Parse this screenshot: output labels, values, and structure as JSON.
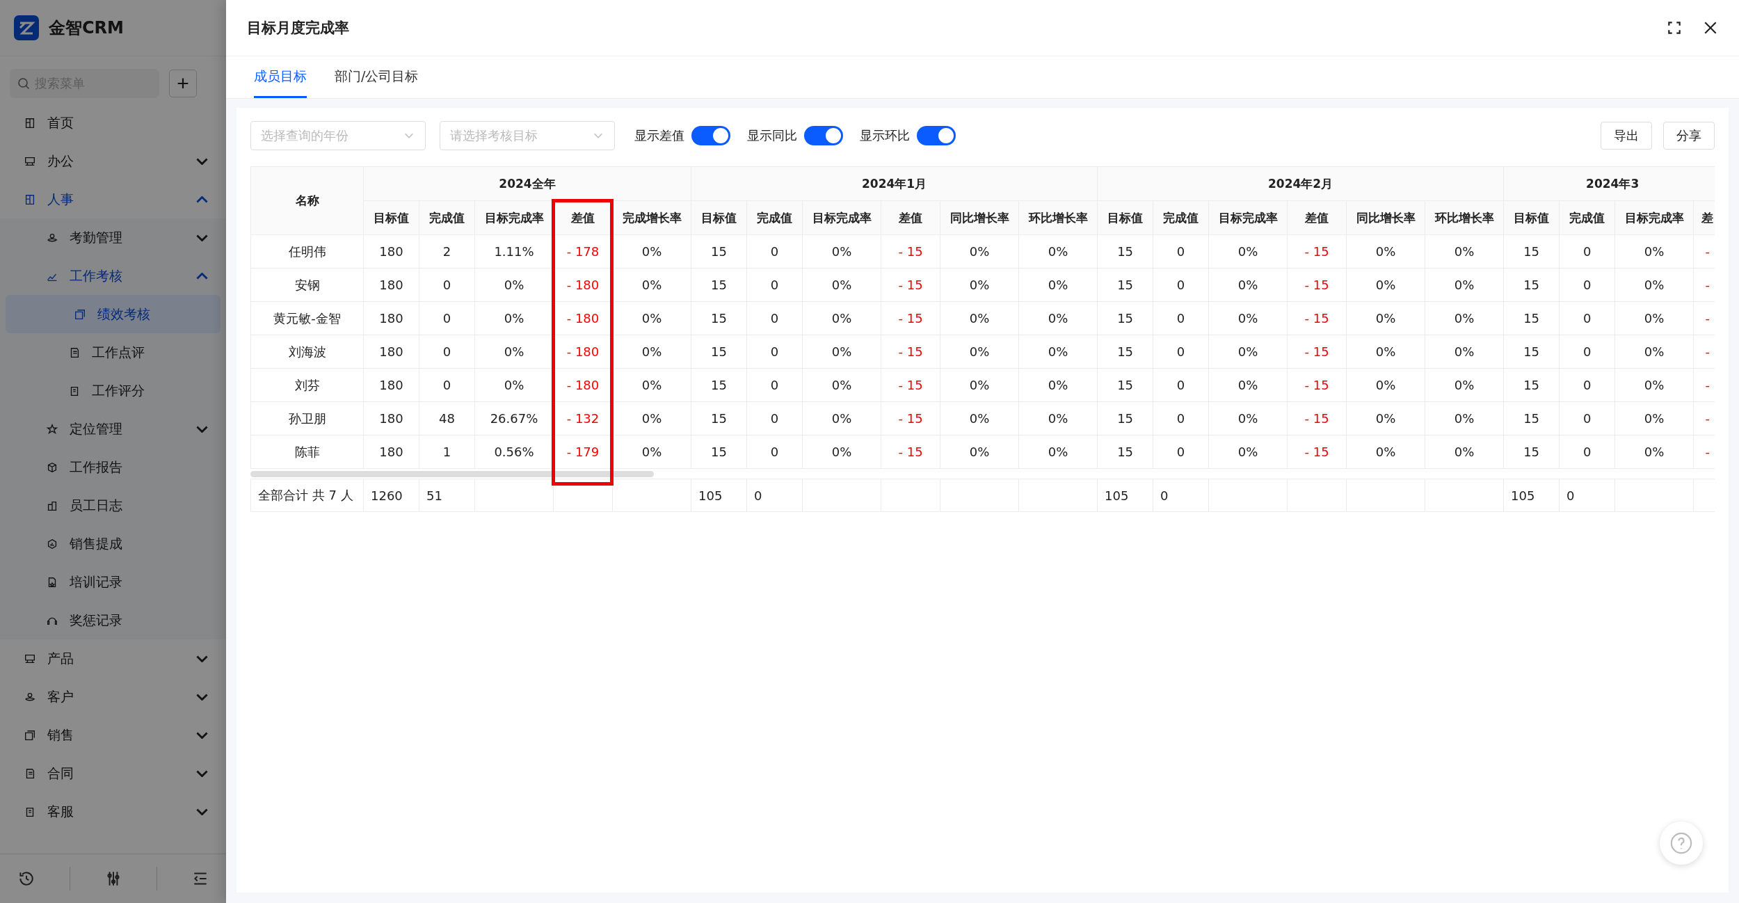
{
  "sidebar": {
    "brand": "金智CRM",
    "search": {
      "placeholder": "搜索菜单"
    },
    "add_button": "+",
    "items": [
      {
        "label": "首页",
        "selected": false
      },
      {
        "label": "办公",
        "selected": false,
        "expanded": false
      },
      {
        "label": "人事",
        "selected": false,
        "expanded": true,
        "children": [
          {
            "label": "考勤管理",
            "selected": false,
            "expanded": false
          },
          {
            "label": "工作考核",
            "selected": false,
            "expanded": true,
            "children": [
              {
                "label": "绩效考核",
                "selected": true
              },
              {
                "label": "工作点评",
                "selected": false
              },
              {
                "label": "工作评分",
                "selected": false
              }
            ]
          },
          {
            "label": "定位管理",
            "selected": false,
            "expanded": false
          },
          {
            "label": "工作报告",
            "selected": false
          },
          {
            "label": "员工日志",
            "selected": false
          },
          {
            "label": "销售提成",
            "selected": false
          },
          {
            "label": "培训记录",
            "selected": false
          },
          {
            "label": "奖惩记录",
            "selected": false
          }
        ]
      },
      {
        "label": "产品",
        "selected": false,
        "expanded": false
      },
      {
        "label": "客户",
        "selected": false,
        "expanded": false
      },
      {
        "label": "销售",
        "selected": false,
        "expanded": false
      },
      {
        "label": "合同",
        "selected": false,
        "expanded": false
      },
      {
        "label": "客服",
        "selected": false,
        "expanded": false
      }
    ]
  },
  "drawer": {
    "title": "目标月度完成率",
    "tabs": [
      {
        "label": "成员目标",
        "selected": true
      },
      {
        "label": "部门/公司目标",
        "selected": false
      }
    ],
    "filters": [
      {
        "placeholder": "选择查询的年份"
      },
      {
        "placeholder": "请选择考核目标"
      }
    ],
    "toggles": [
      {
        "label": "显示差值",
        "on": true
      },
      {
        "label": "显示同比",
        "on": true
      },
      {
        "label": "显示环比",
        "on": true
      }
    ],
    "buttons": [
      "导出",
      "分享"
    ],
    "table": {
      "name_column": "名称",
      "groups": [
        {
          "title": "2024全年",
          "columns": [
            {
              "label": "目标值",
              "kind": "number"
            },
            {
              "label": "完成值",
              "kind": "number"
            },
            {
              "label": "目标完成率",
              "kind": "number"
            },
            {
              "label": "差值",
              "kind": "diff"
            },
            {
              "label": "完成增长率",
              "kind": "number"
            }
          ],
          "totals": [
            "1260",
            "51"
          ]
        },
        {
          "title": "2024年1月",
          "columns": [
            {
              "label": "目标值",
              "kind": "number"
            },
            {
              "label": "完成值",
              "kind": "number"
            },
            {
              "label": "目标完成率",
              "kind": "number"
            },
            {
              "label": "差值",
              "kind": "diff"
            },
            {
              "label": "同比增长率",
              "kind": "number"
            },
            {
              "label": "环比增长率",
              "kind": "number"
            }
          ],
          "totals": [
            "105",
            "0"
          ]
        },
        {
          "title": "2024年2月",
          "columns": [
            {
              "label": "目标值",
              "kind": "number"
            },
            {
              "label": "完成值",
              "kind": "number"
            },
            {
              "label": "目标完成率",
              "kind": "number"
            },
            {
              "label": "差值",
              "kind": "diff"
            },
            {
              "label": "同比增长率",
              "kind": "number"
            },
            {
              "label": "环比增长率",
              "kind": "number"
            }
          ],
          "totals": [
            "105",
            "0"
          ]
        },
        {
          "title": "2024年3",
          "columns": [
            {
              "label": "目标值",
              "kind": "number"
            },
            {
              "label": "完成值",
              "kind": "number"
            },
            {
              "label": "目标完成率",
              "kind": "number"
            },
            {
              "label": "差",
              "kind": "diff"
            }
          ],
          "totals": [
            "105",
            "0"
          ]
        }
      ],
      "rows": [
        {
          "name": "任明伟",
          "values": [
            "180",
            "2",
            "1.11%",
            "- 178",
            "0%",
            "15",
            "0",
            "0%",
            "- 15",
            "0%",
            "0%",
            "15",
            "0",
            "0%",
            "- 15",
            "0%",
            "0%",
            "15",
            "0",
            "0%",
            "-"
          ]
        },
        {
          "name": "安钢",
          "values": [
            "180",
            "0",
            "0%",
            "- 180",
            "0%",
            "15",
            "0",
            "0%",
            "- 15",
            "0%",
            "0%",
            "15",
            "0",
            "0%",
            "- 15",
            "0%",
            "0%",
            "15",
            "0",
            "0%",
            "-"
          ]
        },
        {
          "name": "黄元敏-金智",
          "values": [
            "180",
            "0",
            "0%",
            "- 180",
            "0%",
            "15",
            "0",
            "0%",
            "- 15",
            "0%",
            "0%",
            "15",
            "0",
            "0%",
            "- 15",
            "0%",
            "0%",
            "15",
            "0",
            "0%",
            "-"
          ]
        },
        {
          "name": "刘海波",
          "values": [
            "180",
            "0",
            "0%",
            "- 180",
            "0%",
            "15",
            "0",
            "0%",
            "- 15",
            "0%",
            "0%",
            "15",
            "0",
            "0%",
            "- 15",
            "0%",
            "0%",
            "15",
            "0",
            "0%",
            "-"
          ]
        },
        {
          "name": "刘芬",
          "values": [
            "180",
            "0",
            "0%",
            "- 180",
            "0%",
            "15",
            "0",
            "0%",
            "- 15",
            "0%",
            "0%",
            "15",
            "0",
            "0%",
            "- 15",
            "0%",
            "0%",
            "15",
            "0",
            "0%",
            "-"
          ]
        },
        {
          "name": "孙卫朋",
          "values": [
            "180",
            "48",
            "26.67%",
            "- 132",
            "0%",
            "15",
            "0",
            "0%",
            "- 15",
            "0%",
            "0%",
            "15",
            "0",
            "0%",
            "- 15",
            "0%",
            "0%",
            "15",
            "0",
            "0%",
            "-"
          ]
        },
        {
          "name": "陈菲",
          "values": [
            "180",
            "1",
            "0.56%",
            "- 179",
            "0%",
            "15",
            "0",
            "0%",
            "- 15",
            "0%",
            "0%",
            "15",
            "0",
            "0%",
            "- 15",
            "0%",
            "0%",
            "15",
            "0",
            "0%",
            "-"
          ]
        }
      ],
      "totals_label": "全部合计 共 7 人"
    }
  }
}
